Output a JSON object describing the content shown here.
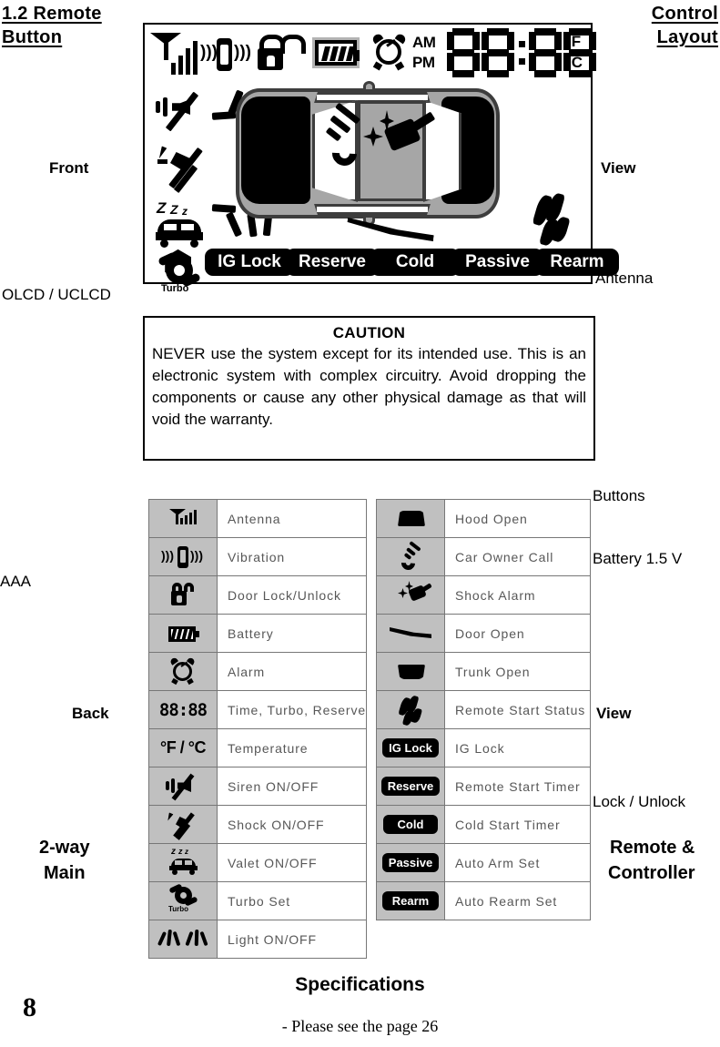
{
  "header": {
    "left": "1.2   Remote",
    "left2": "Button",
    "right": "Control",
    "right2": "Layout"
  },
  "annotations": {
    "front": "Front",
    "view_top": "View",
    "antenna": "Antenna",
    "olcd": "OLCD / UCLCD",
    "buttons": "Buttons",
    "battery": "Battery 1.5 V",
    "aaa": "AAA",
    "back": "Back",
    "view_mid": "View",
    "lock_unlock": "Lock / Unlock",
    "two_way": "2-way",
    "main": "Main",
    "remote_amp": "Remote &",
    "controller": "Controller"
  },
  "lcd": {
    "time": "88:88",
    "am": "AM",
    "pm": "PM",
    "deg_f": "°F",
    "deg_c": "°C",
    "turbo": "Turbo",
    "pills": [
      "IG Lock",
      "Reserve",
      "Cold",
      "Passive",
      "Rearm"
    ],
    "icons": [
      "antenna-icon",
      "vibration-icon",
      "door-lock-unlock-icon",
      "battery-icon",
      "alarm-clock-icon",
      "siren-off-icon",
      "shock-off-icon",
      "valet-zzz-icon",
      "turbo-icon",
      "light-rays-icon",
      "car-top-view",
      "car-owner-call-icon",
      "shock-alarm-icon",
      "remote-start-status-icon",
      "door-open-icon"
    ]
  },
  "caution": {
    "title": "CAUTION",
    "body": "NEVER use the system except for its intended use. This is an electronic system with complex circuitry. Avoid dropping the components or cause any other physical damage as that will void the warranty."
  },
  "legend_left": [
    {
      "icon": "antenna-icon",
      "label": "Antenna"
    },
    {
      "icon": "vibration-icon",
      "label": "Vibration"
    },
    {
      "icon": "door-lock-unlock-icon",
      "label": "Door  Lock/Unlock"
    },
    {
      "icon": "battery-icon",
      "label": "Battery"
    },
    {
      "icon": "alarm-clock-icon",
      "label": "Alarm"
    },
    {
      "icon": "segment-time-icon",
      "label": "Time,  Turbo,  Reserve",
      "text": "88:88"
    },
    {
      "icon": "temperature-icon",
      "label": "Temperature",
      "text": "°F / °C"
    },
    {
      "icon": "siren-onoff-icon",
      "label": "Siren  ON/OFF"
    },
    {
      "icon": "shock-onoff-icon",
      "label": "Shock  ON/OFF"
    },
    {
      "icon": "valet-onoff-icon",
      "label": "Valet  ON/OFF"
    },
    {
      "icon": "turbo-icon",
      "label": "Turbo  Set",
      "text": "Turbo"
    },
    {
      "icon": "light-onoff-icon",
      "label": "Light  ON/OFF"
    }
  ],
  "legend_right": [
    {
      "icon": "hood-open-icon",
      "label": "Hood  Open"
    },
    {
      "icon": "car-owner-call-icon",
      "label": "Car  Owner  Call"
    },
    {
      "icon": "shock-alarm-icon",
      "label": "Shock  Alarm"
    },
    {
      "icon": "door-open-icon",
      "label": "Door  Open"
    },
    {
      "icon": "trunk-open-icon",
      "label": "Trunk  Open"
    },
    {
      "icon": "remote-start-status-icon",
      "label": "Remote  Start  Status"
    },
    {
      "icon": "ig-lock-pill",
      "label": "IG  Lock",
      "text": "IG Lock"
    },
    {
      "icon": "reserve-pill",
      "label": "Remote  Start  Timer",
      "text": "Reserve"
    },
    {
      "icon": "cold-pill",
      "label": "Cold  Start  Timer",
      "text": "Cold"
    },
    {
      "icon": "passive-pill",
      "label": "Auto  Arm  Set",
      "text": "Passive"
    },
    {
      "icon": "rearm-pill",
      "label": "Auto  Rearm  Set",
      "text": "Rearm"
    }
  ],
  "footer": {
    "page_number": "8",
    "spec_title": "Specifications",
    "spec_note": "- Please see the page 26"
  },
  "colors": {
    "lcd_gray": "#a6a6a6",
    "cell_gray": "#c0c0c0",
    "label_gray": "#575757",
    "black": "#000000"
  }
}
